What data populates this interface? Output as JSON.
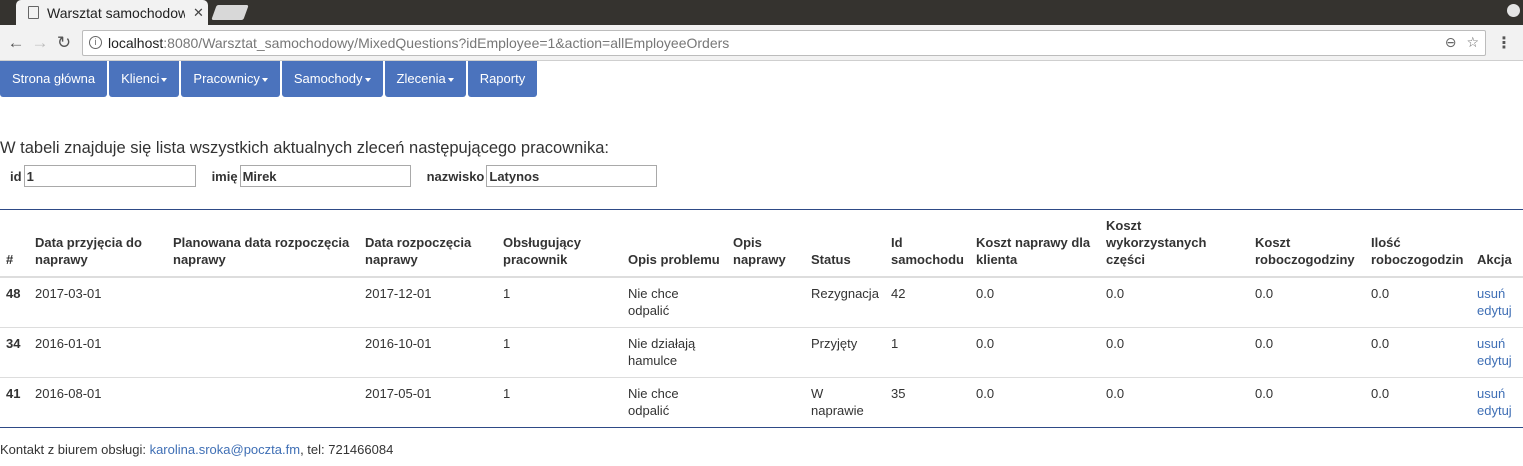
{
  "browser": {
    "tab_title": "Warsztat samochodowy",
    "url_host": "localhost",
    "url_rest": ":8080/Warsztat_samochodowy/MixedQuestions?idEmployee=1&action=allEmployeeOrders"
  },
  "nav": [
    {
      "label": "Strona główna",
      "dropdown": false
    },
    {
      "label": "Klienci",
      "dropdown": true
    },
    {
      "label": "Pracownicy",
      "dropdown": true
    },
    {
      "label": "Samochody",
      "dropdown": true
    },
    {
      "label": "Zlecenia",
      "dropdown": true
    },
    {
      "label": "Raporty",
      "dropdown": false
    }
  ],
  "intro_text": "W tabeli znajduje się lista wszystkich aktualnych zleceń następującego pracownika:",
  "employee": {
    "id_label": "id",
    "id_value": "1",
    "first_label": "imię",
    "first_value": "Mirek",
    "last_label": "nazwisko",
    "last_value": "Latynos"
  },
  "table": {
    "headers": [
      "#",
      "Data przyjęcia do naprawy",
      "Planowana data rozpoczęcia naprawy",
      "Data rozpoczęcia naprawy",
      "Obsługujący pracownik",
      "Opis problemu",
      "Opis naprawy",
      "Status",
      "Id samochodu",
      "Koszt naprawy dla klienta",
      "Koszt wykorzystanych części",
      "Koszt roboczogodziny",
      "Ilość roboczogodzin",
      "Akcja"
    ],
    "rows": [
      {
        "id": "48",
        "received": "2017-03-01",
        "planned": "",
        "started": "2017-12-01",
        "employee": "1",
        "problem": "Nie chce odpalić",
        "repair": "",
        "status": "Rezygnacja",
        "car_id": "42",
        "cost_client": "0.0",
        "cost_parts": "0.0",
        "cost_hour": "0.0",
        "hours": "0.0",
        "delete": "usuń",
        "edit": "edytuj"
      },
      {
        "id": "34",
        "received": "2016-01-01",
        "planned": "",
        "started": "2016-10-01",
        "employee": "1",
        "problem": "Nie działają hamulce",
        "repair": "",
        "status": "Przyjęty",
        "car_id": "1",
        "cost_client": "0.0",
        "cost_parts": "0.0",
        "cost_hour": "0.0",
        "hours": "0.0",
        "delete": "usuń",
        "edit": "edytuj"
      },
      {
        "id": "41",
        "received": "2016-08-01",
        "planned": "",
        "started": "2017-05-01",
        "employee": "1",
        "problem": "Nie chce odpalić",
        "repair": "",
        "status": "W naprawie",
        "car_id": "35",
        "cost_client": "0.0",
        "cost_parts": "0.0",
        "cost_hour": "0.0",
        "hours": "0.0",
        "delete": "usuń",
        "edit": "edytuj"
      }
    ]
  },
  "footer": {
    "prefix": "Kontakt z biurem obsługi: ",
    "email": "karolina.sroka@poczta.fm",
    "suffix": ", tel: 721466084"
  }
}
